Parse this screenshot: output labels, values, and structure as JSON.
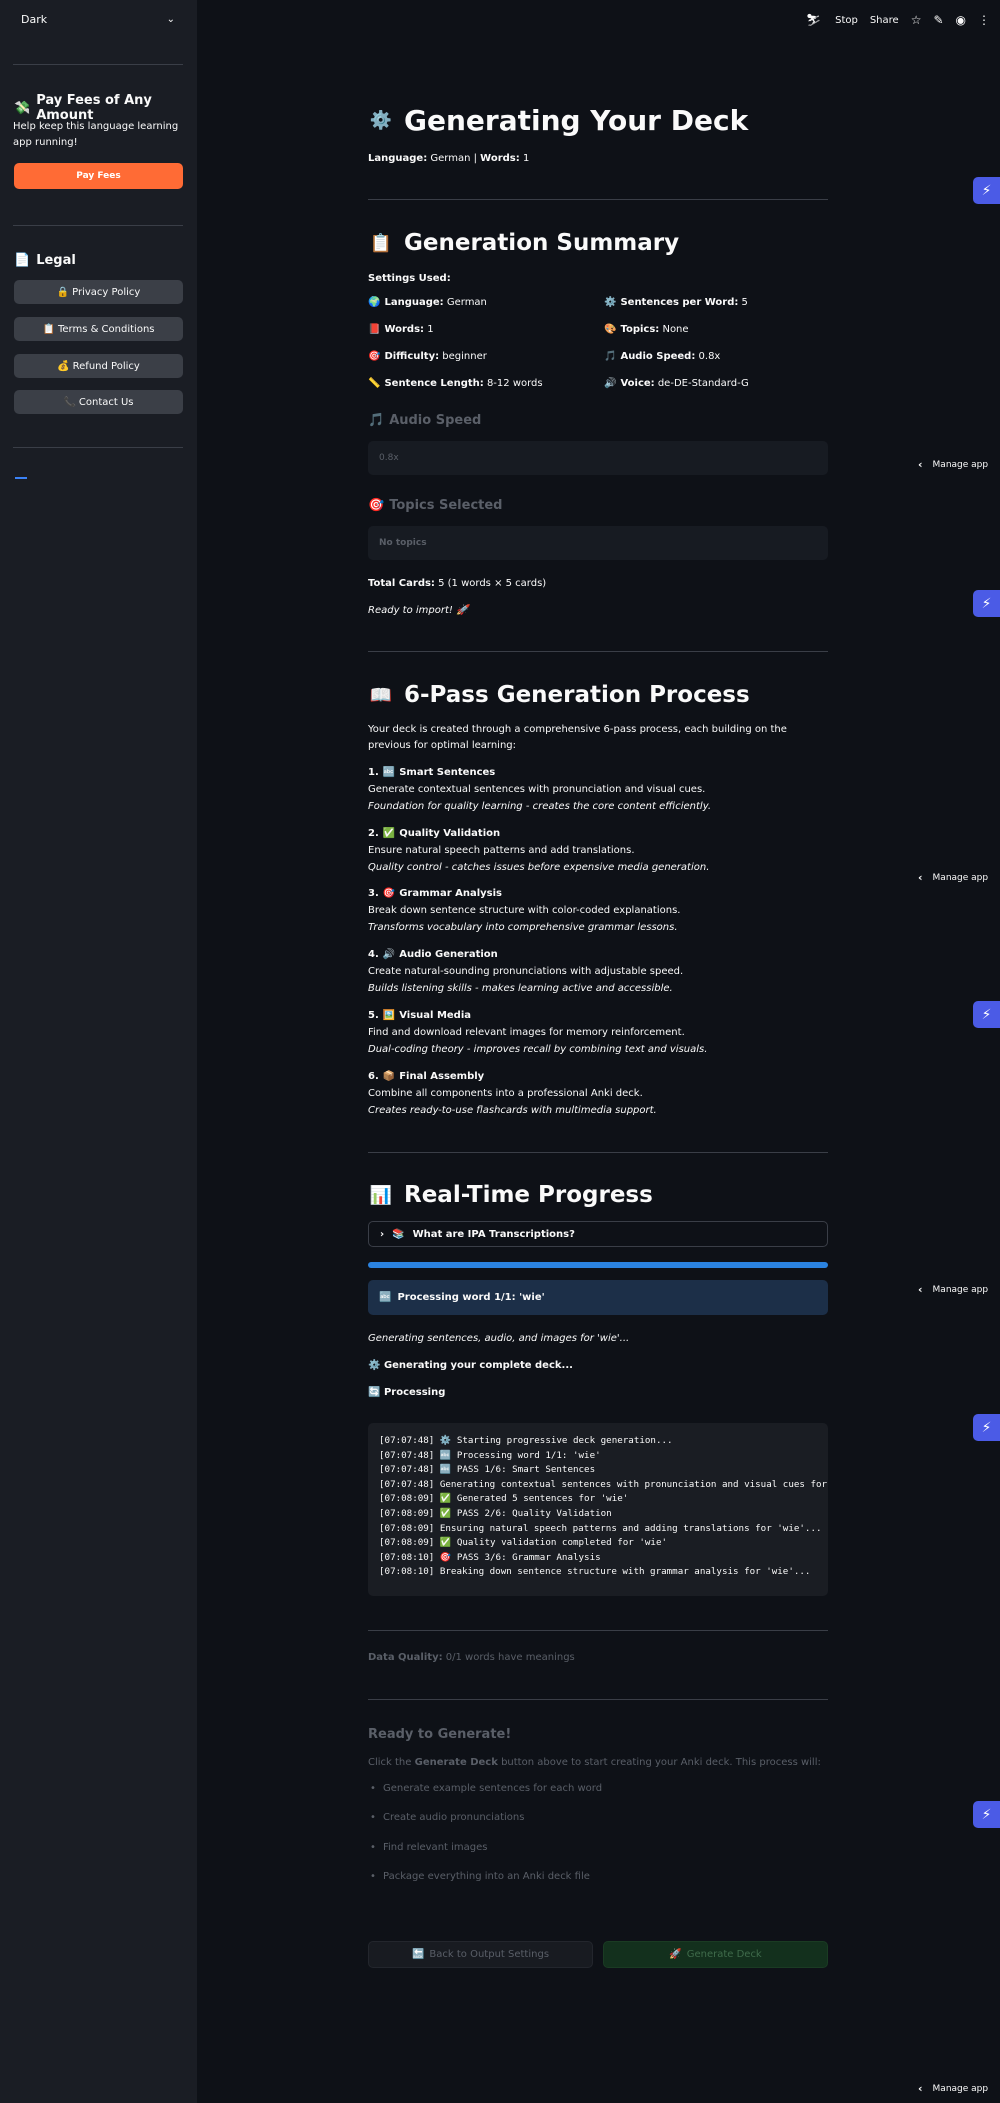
{
  "sidebar": {
    "theme_value": "Dark",
    "pay": {
      "heading": "Pay Fees of Any Amount",
      "heading_icon": "money-with-wings",
      "text": "Help keep this language learning app running!",
      "button": "Pay Fees"
    },
    "legal": {
      "heading": "Legal",
      "heading_icon": "document",
      "items": [
        {
          "icon": "🔒",
          "label": "Privacy Policy"
        },
        {
          "icon": "📋",
          "label": "Terms & Conditions"
        },
        {
          "icon": "💰",
          "label": "Refund Policy"
        },
        {
          "icon": "📞",
          "label": "Contact Us"
        }
      ]
    }
  },
  "toolbar": {
    "stop": "Stop",
    "share": "Share"
  },
  "overlay": {
    "manage_app": "Manage app"
  },
  "header": {
    "title": "Generating Your Deck",
    "language_label": "Language:",
    "language_value": " German | ",
    "words_label": "Words:",
    "words_value": " 1"
  },
  "summary": {
    "title": "Generation Summary",
    "settings_used": "Settings Used:",
    "settings": [
      {
        "icon": "🌍",
        "label": "Language:",
        "value": " German"
      },
      {
        "icon": "⚙️",
        "label": "Sentences per Word:",
        "value": " 5"
      },
      {
        "icon": "📕",
        "label": "Words:",
        "value": " 1"
      },
      {
        "icon": "🎨",
        "label": "Topics:",
        "value": " None"
      },
      {
        "icon": "🎯",
        "label": "Difficulty:",
        "value": " beginner"
      },
      {
        "icon": "🎵",
        "label": "Audio Speed:",
        "value": " 0.8x"
      },
      {
        "icon": "📏",
        "label": "Sentence Length:",
        "value": " 8-12 words"
      },
      {
        "icon": "🔊",
        "label": "Voice:",
        "value": " de-DE-Standard-G"
      }
    ],
    "audio_speed_heading": "Audio Speed",
    "audio_speed_value": "0.8x",
    "topics_heading": "Topics Selected",
    "topics_value": "No topics",
    "total_cards_label": "Total Cards:",
    "total_cards_value": " 5 (1 words × 5 cards)",
    "ready": "Ready to import! 🚀"
  },
  "process": {
    "title": "6-Pass Generation Process",
    "intro": "Your deck is created through a comprehensive 6-pass process, each building on the previous for optimal learning:",
    "steps": [
      {
        "num": "1.",
        "icon": "🔤",
        "title": "Smart Sentences",
        "desc": "Generate contextual sentences with pronunciation and visual cues.",
        "note": "Foundation for quality learning - creates the core content efficiently."
      },
      {
        "num": "2.",
        "icon": "✅",
        "title": "Quality Validation",
        "desc": "Ensure natural speech patterns and add translations.",
        "note": "Quality control - catches issues before expensive media generation."
      },
      {
        "num": "3.",
        "icon": "🎯",
        "title": "Grammar Analysis",
        "desc": "Break down sentence structure with color-coded explanations.",
        "note": "Transforms vocabulary into comprehensive grammar lessons."
      },
      {
        "num": "4.",
        "icon": "🔊",
        "title": "Audio Generation",
        "desc": "Create natural-sounding pronunciations with adjustable speed.",
        "note": "Builds listening skills - makes learning active and accessible."
      },
      {
        "num": "5.",
        "icon": "🖼️",
        "title": "Visual Media",
        "desc": "Find and download relevant images for memory reinforcement.",
        "note": "Dual-coding theory - improves recall by combining text and visuals."
      },
      {
        "num": "6.",
        "icon": "📦",
        "title": "Final Assembly",
        "desc": "Combine all components into a professional Anki deck.",
        "note": "Creates ready-to-use flashcards with multimedia support."
      }
    ]
  },
  "progress": {
    "title": "Real-Time Progress",
    "expander": "What are IPA Transcriptions?",
    "percent": 100,
    "info": "Processing word 1/1: 'wie'",
    "generating_note": "Generating sentences, audio, and images for 'wie'...",
    "generating_complete": "Generating your complete deck...",
    "status": "Processing",
    "log": [
      "[07:07:48] ⚙️ Starting progressive deck generation...",
      "[07:07:48] 🔤 Processing word 1/1: 'wie'",
      "[07:07:48] 🔤 PASS 1/6: Smart Sentences",
      "[07:07:48] Generating contextual sentences with pronunciation and visual cues for",
      "[07:08:09] ✅ Generated 5 sentences for 'wie'",
      "[07:08:09] ✅ PASS 2/6: Quality Validation",
      "[07:08:09] Ensuring natural speech patterns and adding translations for 'wie'...",
      "[07:08:09] ✅ Quality validation completed for 'wie'",
      "[07:08:10] 🎯 PASS 3/6: Grammar Analysis",
      "[07:08:10] Breaking down sentence structure with grammar analysis for 'wie'..."
    ]
  },
  "quality": {
    "label": "Data Quality:",
    "value": " 0/1 words have meanings"
  },
  "ready_section": {
    "title": "Ready to Generate!",
    "text_before": "Click the ",
    "text_bold": "Generate Deck",
    "text_after": " button above to start creating your Anki deck. This process will:",
    "items": [
      "Generate example sentences for each word",
      "Create audio pronunciations",
      "Find relevant images",
      "Package everything into an Anki deck file"
    ]
  },
  "buttons": {
    "back": "Back to Output Settings",
    "generate": "Generate Deck"
  }
}
